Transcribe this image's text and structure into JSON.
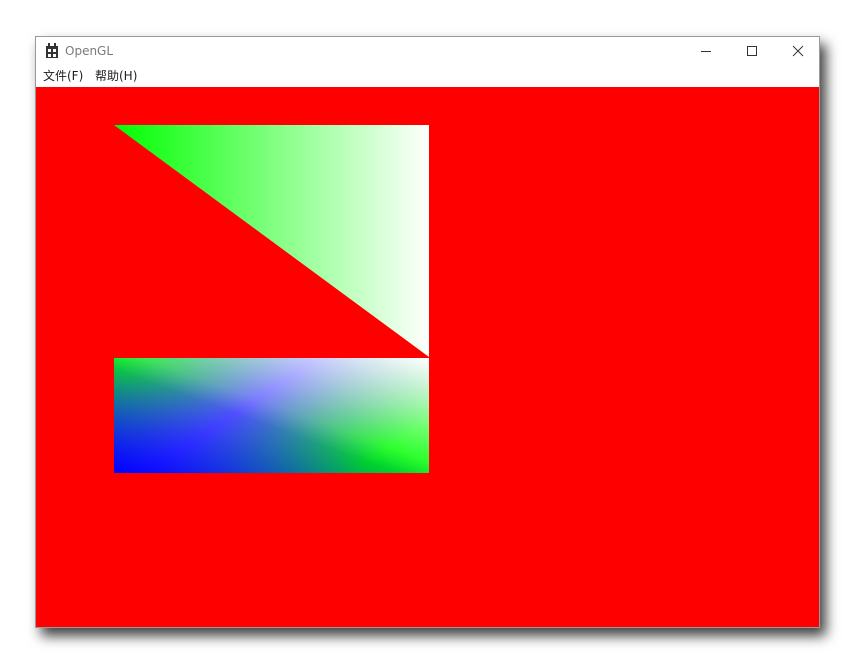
{
  "window": {
    "title": "OpenGL",
    "minimize_icon": "minimize-icon",
    "maximize_icon": "maximize-icon",
    "close_icon": "close-icon"
  },
  "menubar": {
    "items": [
      {
        "label": "文件(F)"
      },
      {
        "label": "帮助(H)"
      }
    ]
  },
  "canvas": {
    "clear_color": "#ff0000",
    "shapes": {
      "triangle": {
        "colors": [
          "#00ff00",
          "#ffffff"
        ]
      },
      "quad": {
        "colors": [
          "#00ff00",
          "#ffffff",
          "#0000ff",
          "#00ff00"
        ]
      }
    }
  }
}
